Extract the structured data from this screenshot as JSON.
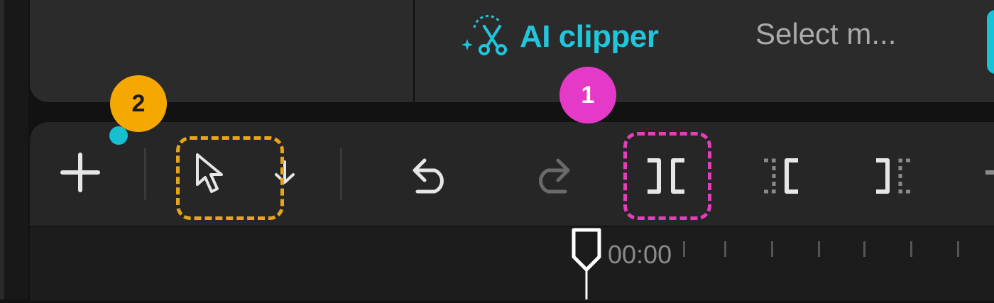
{
  "header": {
    "ai_clipper_label": "AI clipper",
    "select_media_label": "Select m..."
  },
  "toolbar": {
    "add_icon": "plus-icon",
    "select_icon": "cursor-arrow-icon",
    "select_dropdown_icon": "chevron-down-icon",
    "undo_icon": "undo-icon",
    "redo_icon": "redo-icon",
    "split_icon": "split-icon",
    "split_left_icon": "split-left-icon",
    "split_right_icon": "split-right-icon"
  },
  "annotations": {
    "badge_1": "1",
    "badge_2": "2",
    "highlight_colors": {
      "badge_1": "#e53ac8",
      "badge_2": "#f5a800"
    }
  },
  "timeline": {
    "timecode": "00:00"
  },
  "colors": {
    "accent_teal": "#22c6dc",
    "panel_bg": "#2b2b2b",
    "toolbar_bg": "#262626"
  }
}
